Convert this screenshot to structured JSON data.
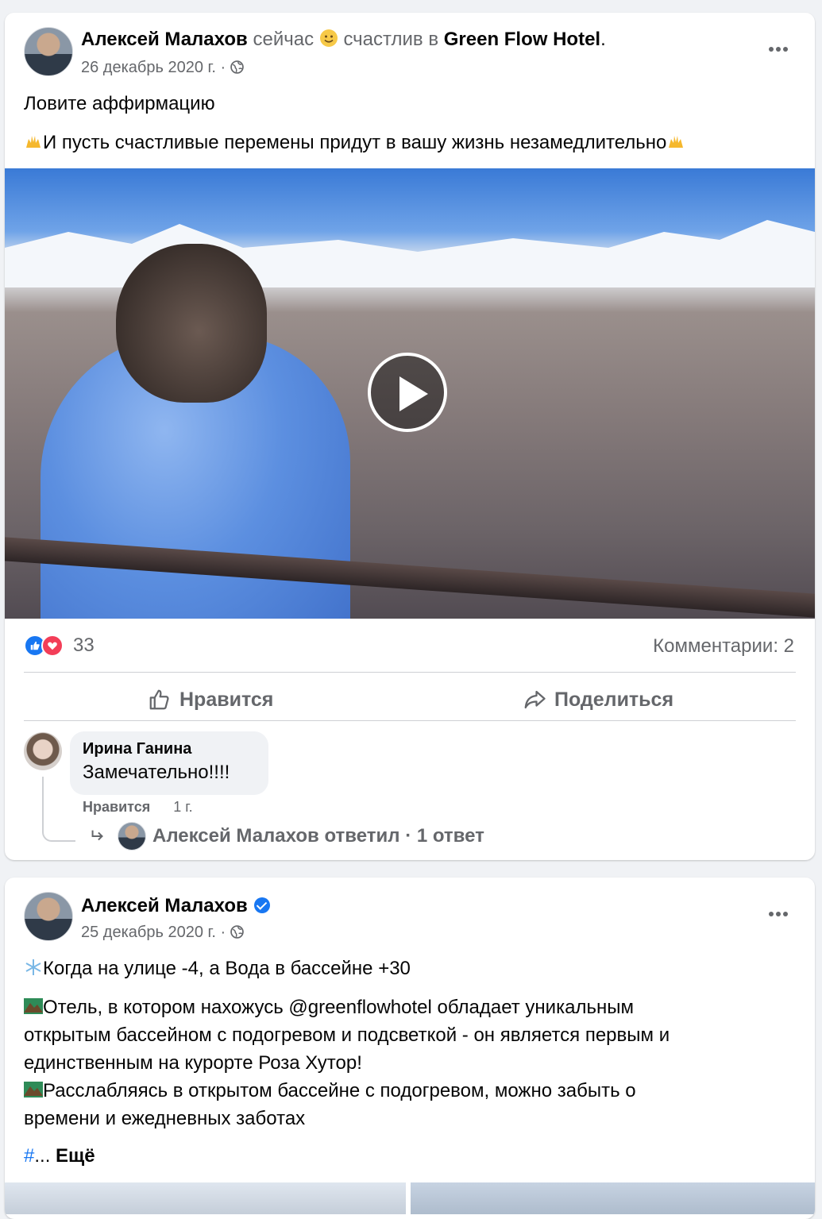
{
  "posts": [
    {
      "author": "Алексей Малахов",
      "time_label": "сейчас",
      "feeling_text": "счастлив в",
      "place": "Green Flow Hotel",
      "place_suffix": ".",
      "date": "26 декабрь 2020 г. ·",
      "text_line1": "Ловите аффирмацию",
      "text_line2": "И пусть счастливые перемены придут в вашу жизнь незамедлительно",
      "reactions_count": "33",
      "comments_label": "Комментарии: 2",
      "like_label": "Нравится",
      "share_label": "Поделиться",
      "comment": {
        "author": "Ирина Ганина",
        "text": "Замечательно!!!!",
        "like_label": "Нравится",
        "age": "1 г."
      },
      "reply_summary": "Алексей Малахов ответил · 1 ответ"
    },
    {
      "author": "Алексей Малахов",
      "date": "25 декабрь 2020 г. ·",
      "line1": "Когда на улице -4, а Вода в бассейне +30",
      "para2_line1": "Отель, в котором нахожусь @greenflowhotel обладает уникальным",
      "para2_line2": "открытым бассейном с подогревом и подсветкой - он является первым и",
      "para2_line3": "единственным на курорте Роза Хутор!",
      "para3_line1": "Расслабляясь в открытом бассейне с подогревом, можно забыть о",
      "para3_line2": "времени и ежедневных заботах",
      "hashtag": "#",
      "ellipsis": "...",
      "more_label": "Ещё"
    }
  ],
  "colors": {
    "accent": "#1877f2",
    "muted": "#65676b",
    "love": "#f33e58",
    "background": "#f0f2f5"
  },
  "icons": [
    "smile-emoji-icon",
    "globe-icon",
    "more-icon",
    "raising-hands-icon",
    "play-icon",
    "like-reaction-icon",
    "love-reaction-icon",
    "thumbs-up-icon",
    "share-arrow-icon",
    "reply-arrow-icon",
    "verified-badge-icon",
    "snowflake-icon",
    "mountain-icon"
  ]
}
